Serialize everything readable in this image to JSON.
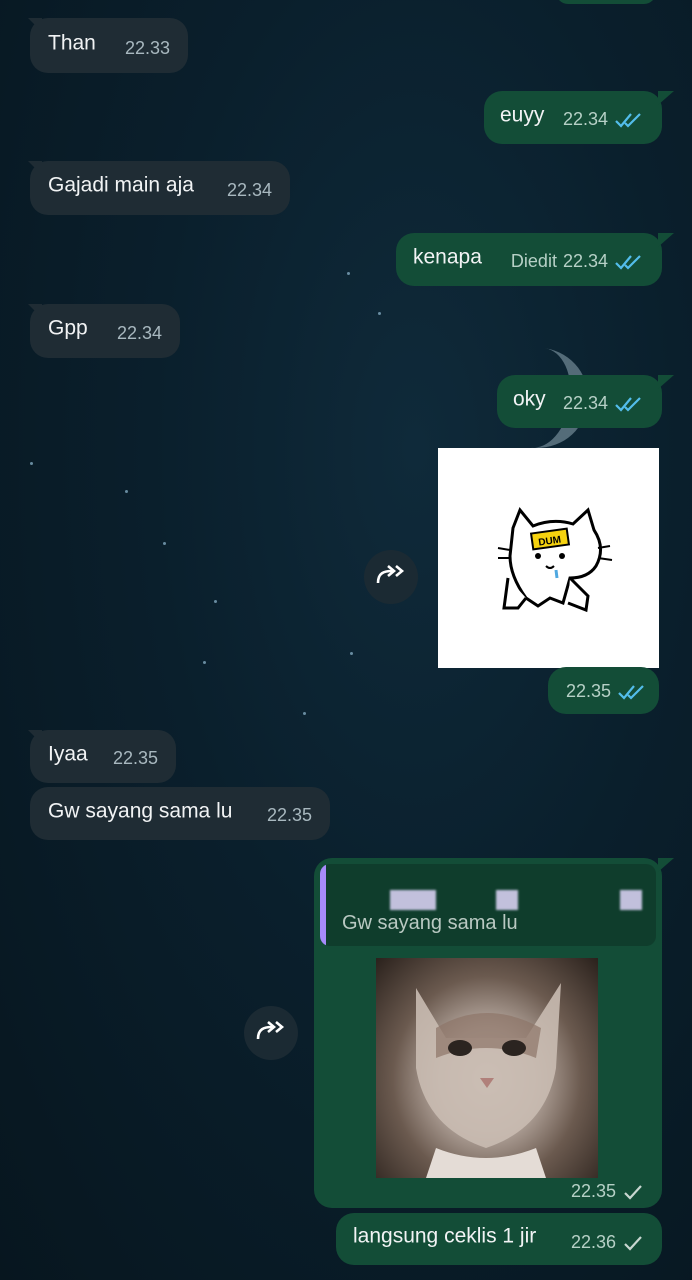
{
  "messages": [
    {
      "text": "Than",
      "time": "22.33"
    },
    {
      "text": "euyy",
      "time": "22.34"
    },
    {
      "text": "Gajadi main aja",
      "time": "22.34"
    },
    {
      "text": "kenapa",
      "edited": "Diedit",
      "time": "22.34"
    },
    {
      "text": "Gpp",
      "time": "22.34"
    },
    {
      "text": "oky",
      "time": "22.34"
    },
    {
      "sticker_text": "DUM",
      "time": "22.35"
    },
    {
      "text": "Iyaa",
      "time": "22.35"
    },
    {
      "text": "Gw sayang sama lu",
      "time": "22.35"
    },
    {
      "quoted_text": "Gw sayang sama lu",
      "time": "22.35"
    },
    {
      "text": "langsung ceklis 1 jir",
      "time": "22.36"
    }
  ],
  "icons": {
    "read_ticks": "double-check-icon",
    "sent_tick": "single-check-icon",
    "forward": "forward-icon"
  },
  "colors": {
    "incoming_bubble": "#1f2c34",
    "outgoing_bubble": "#134d37",
    "read_tick": "#53bdeb",
    "quote_bar": "#a78bfa"
  }
}
